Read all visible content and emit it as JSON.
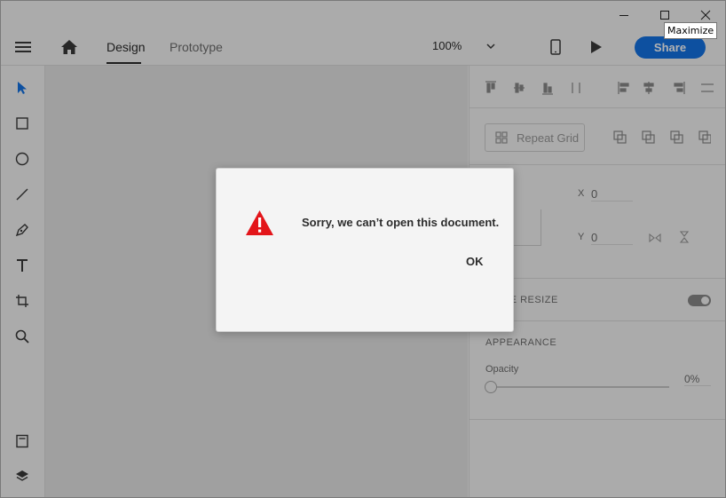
{
  "window": {
    "controls": {
      "minimize_icon": "minimize-icon",
      "maximize_icon": "maximize-icon",
      "close_icon": "close-icon"
    },
    "tooltip": "Maximize"
  },
  "appbar": {
    "tabs": [
      {
        "label": "Design",
        "active": true
      },
      {
        "label": "Prototype",
        "active": false
      }
    ],
    "zoom": "100%",
    "share_label": "Share"
  },
  "tools": [
    "select-tool-icon",
    "rectangle-tool-icon",
    "ellipse-tool-icon",
    "line-tool-icon",
    "pen-tool-icon",
    "text-tool-icon",
    "artboard-tool-icon",
    "zoom-tool-icon",
    "assets-icon",
    "layers-icon"
  ],
  "panel": {
    "repeat_grid_label": "Repeat Grid",
    "x_label": "X",
    "x_value": "0",
    "y_label": "Y",
    "y_value": "0",
    "responsive_resize_label": "NSIVE RESIZE",
    "appearance_label": "APPEARANCE",
    "opacity_label": "Opacity",
    "opacity_value": "0%"
  },
  "dialog": {
    "message": "Sorry, we can’t open this document.",
    "ok_label": "OK",
    "icon": "warning-icon"
  },
  "colors": {
    "accent": "#1473e6",
    "warning": "#e3151a",
    "canvas": "#e6e6e6",
    "chrome": "#f5f5f5"
  }
}
